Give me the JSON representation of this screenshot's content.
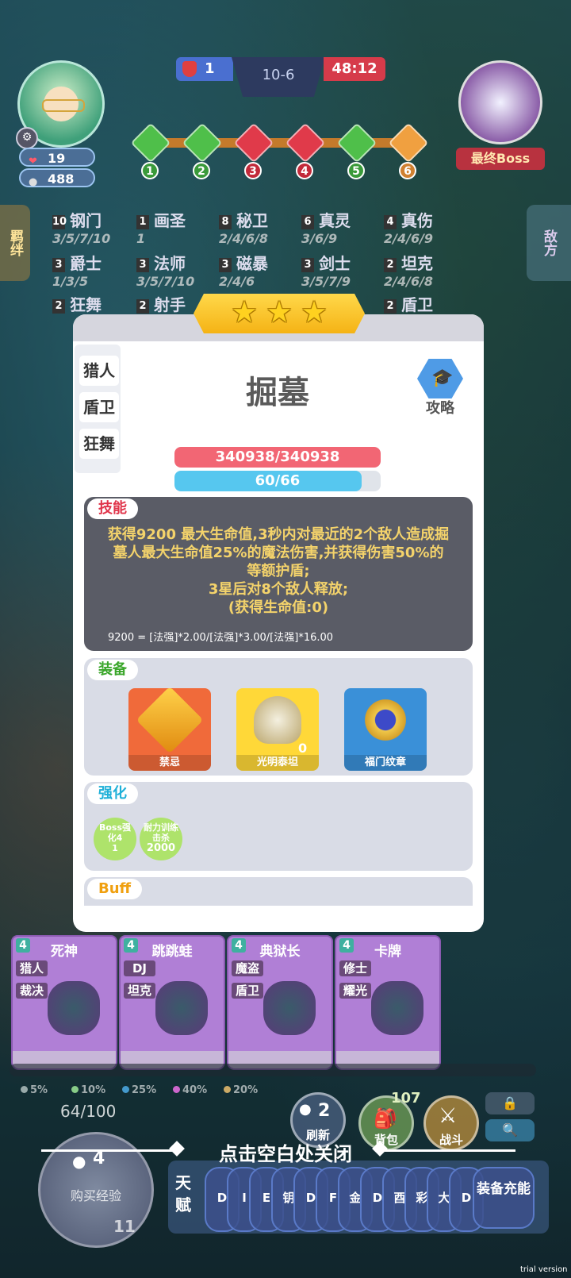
{
  "hud": {
    "health": "19",
    "gold": "488",
    "score_left": "1",
    "round": "10-6",
    "timer": "48:12",
    "boss_label": "最终Boss",
    "stages": [
      "1",
      "2",
      "3",
      "4",
      "5",
      "6"
    ]
  },
  "side_tabs": {
    "left": "羁绊",
    "right": "敌方"
  },
  "synergies": [
    {
      "count": "10",
      "name": "钢门",
      "levels": "3/5/7/10"
    },
    {
      "count": "1",
      "name": "画圣",
      "levels": "1"
    },
    {
      "count": "8",
      "name": "秘卫",
      "levels": "2/4/6/8"
    },
    {
      "count": "6",
      "name": "真灵",
      "levels": "3/6/9"
    },
    {
      "count": "4",
      "name": "真伤",
      "levels": "2/4/6/9"
    },
    {
      "count": "3",
      "name": "爵士",
      "levels": "1/3/5"
    },
    {
      "count": "3",
      "name": "法师",
      "levels": "3/5/7/10"
    },
    {
      "count": "3",
      "name": "磁暴",
      "levels": "2/4/6"
    },
    {
      "count": "3",
      "name": "剑士",
      "levels": "3/5/7/9"
    },
    {
      "count": "2",
      "name": "坦克",
      "levels": "2/4/6/8"
    },
    {
      "count": "2",
      "name": "狂舞",
      "levels": ""
    },
    {
      "count": "2",
      "name": "射手",
      "levels": ""
    },
    {
      "count": "2",
      "name": "盾卫",
      "levels": ""
    }
  ],
  "hero": {
    "stars": 3,
    "name": "掘墓",
    "traits": [
      "猎人",
      "盾卫",
      "狂舞"
    ],
    "guide_label": "攻略",
    "hp_text": "340938/340938",
    "hp_fraction": 1.0,
    "mana_text": "60/66",
    "mana_fraction": 0.909
  },
  "skill": {
    "tag": "技能",
    "lines": [
      "获得9200 最大生命值,3秒内对最近的2个敌人造成掘",
      "墓人最大生命值25%的魔法伤害,并获得伤害50%的",
      "等额护盾;",
      "3星后对8个敌人释放;",
      "(获得生命值:0)"
    ],
    "formula": "9200 = [法强]*2.00/[法强]*3.00/[法强]*16.00"
  },
  "equipment": {
    "tag": "装备",
    "items": [
      {
        "name": "禁忌",
        "badge": ""
      },
      {
        "name": "光明泰坦",
        "badge": "0"
      },
      {
        "name": "福门纹章",
        "badge": ""
      }
    ]
  },
  "enhance": {
    "tag": "强化",
    "items": [
      {
        "l1": "Boss强",
        "l2": "化4",
        "l3": "1"
      },
      {
        "l1": "耐力训练",
        "l2": "击杀",
        "l3": "2000"
      }
    ]
  },
  "buff": {
    "tag": "Buff"
  },
  "shop": [
    {
      "cost": "4",
      "name": "死神",
      "tags": [
        "猎人",
        "裁决"
      ]
    },
    {
      "cost": "4",
      "name": "跳跳蛙",
      "tags": [
        "DJ",
        "坦克"
      ]
    },
    {
      "cost": "4",
      "name": "典狱长",
      "tags": [
        "魔盗",
        "盾卫"
      ]
    },
    {
      "cost": "4",
      "name": "卡牌",
      "tags": [
        "修士",
        "耀光"
      ]
    }
  ],
  "odds": [
    "5%",
    "10%",
    "25%",
    "40%",
    "20%"
  ],
  "bottom": {
    "xp": "64/100",
    "buy_cost": "4",
    "buy_label": "购买经验",
    "level": "11",
    "refresh_cost": "2",
    "refresh_label": "刷新",
    "bag_count": "107",
    "bag_label": "背包",
    "battle_label": "战斗",
    "close_hint": "点击空白处关闭",
    "talent_label": "天赋",
    "talent_cards": [
      "D",
      "I",
      "E",
      "钥",
      "D",
      "F",
      "金",
      "D",
      "酉",
      "彩",
      "大",
      "D"
    ],
    "equip_recharge": "装备充能"
  },
  "watermark": "trial version",
  "colors": {
    "hp": "#f26674",
    "mana": "#56c7ef",
    "skill_bg": "#5a5c66",
    "section_bg": "#d9dce6",
    "accent_gold": "#ffd21f"
  }
}
